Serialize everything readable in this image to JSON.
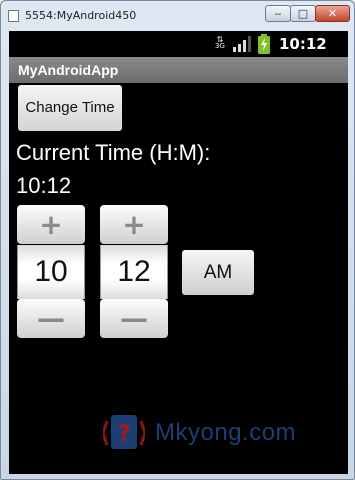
{
  "window": {
    "title": "5554:MyAndroid450",
    "min_glyph": "‒",
    "max_glyph": "□",
    "close_glyph": "✕"
  },
  "statusbar": {
    "network_label": "3G",
    "clock": "10:12"
  },
  "appbar": {
    "title": "MyAndroidApp"
  },
  "main": {
    "change_time_label": "Change Time",
    "current_time_label": "Current Time (H:M):",
    "current_time_value": "10:12",
    "hour_picker": {
      "increment_glyph": "+",
      "value": "10",
      "decrement_glyph": "—"
    },
    "minute_picker": {
      "increment_glyph": "+",
      "value": "12",
      "decrement_glyph": "—"
    },
    "ampm_label": "AM"
  },
  "watermark": {
    "text": "Mkyong.com"
  },
  "colors": {
    "screen_bg": "#000000",
    "appbar_bg": "#7a7a7a",
    "battery_green": "#7ec12a",
    "watermark_blue": "#1c3f73"
  }
}
